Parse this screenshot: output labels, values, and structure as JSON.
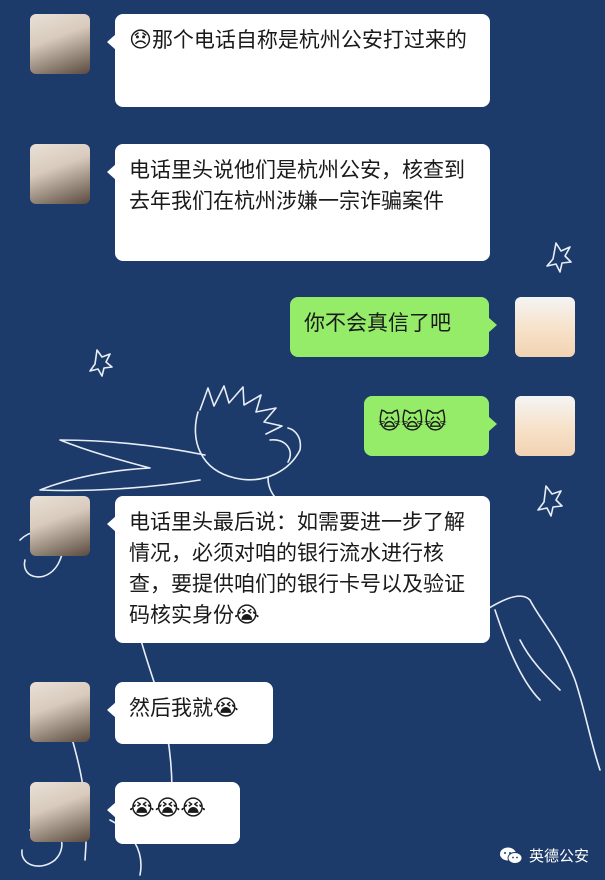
{
  "messages": [
    {
      "side": "left",
      "avatar": "girl-avatar",
      "emoji_before": "😞",
      "text": "那个电话自称是杭州公安打过来的"
    },
    {
      "side": "left",
      "avatar": "girl-avatar",
      "text": "电话里头说他们是杭州公安，核查到去年我们在杭州涉嫌一宗诈骗案件"
    },
    {
      "side": "right",
      "avatar": "boy-avatar",
      "text": "你不会真信了吧"
    },
    {
      "side": "right",
      "avatar": "boy-avatar",
      "emoji_text": "🙀🙀🙀"
    },
    {
      "side": "left",
      "avatar": "girl-avatar",
      "text": "电话里头最后说：如需要进一步了解情况，必须对咱的银行流水进行核查，要提供咱们的银行卡号以及验证码核实身份",
      "emoji_after": "😭"
    },
    {
      "side": "left",
      "avatar": "girl-avatar",
      "text": "然后我就",
      "emoji_after": "😭"
    },
    {
      "side": "left",
      "avatar": "girl-avatar",
      "emoji_text": "😭😭😭"
    }
  ],
  "watermark": {
    "icon": "wechat-icon",
    "text": "英德公安"
  },
  "colors": {
    "background": "#1c3a6a",
    "left_bubble": "#ffffff",
    "right_bubble": "#95ec69"
  }
}
